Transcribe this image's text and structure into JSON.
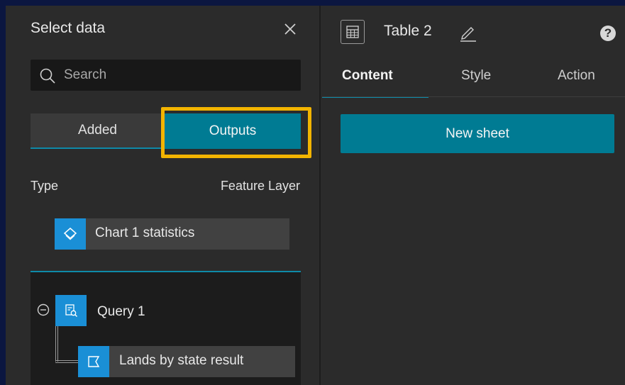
{
  "left_panel": {
    "title": "Select data",
    "search": {
      "placeholder": "Search",
      "value": ""
    },
    "tabs": {
      "added": "Added",
      "outputs": "Outputs"
    },
    "type_label": "Type",
    "type_value": "Feature Layer",
    "chart_item": {
      "label": "Chart 1 statistics",
      "icon": "layers-icon"
    },
    "tree": {
      "query_label": "Query 1",
      "result_label": "Lands by state result"
    }
  },
  "right_panel": {
    "title": "Table 2",
    "tabs": {
      "content": "Content",
      "style": "Style",
      "action": "Action"
    },
    "new_sheet_label": "New sheet"
  },
  "colors": {
    "accent": "#007b93",
    "icon_blue": "#1a8fd6",
    "highlight": "#f3b400",
    "panel": "#2b2b2b",
    "background": "#0b1640"
  }
}
